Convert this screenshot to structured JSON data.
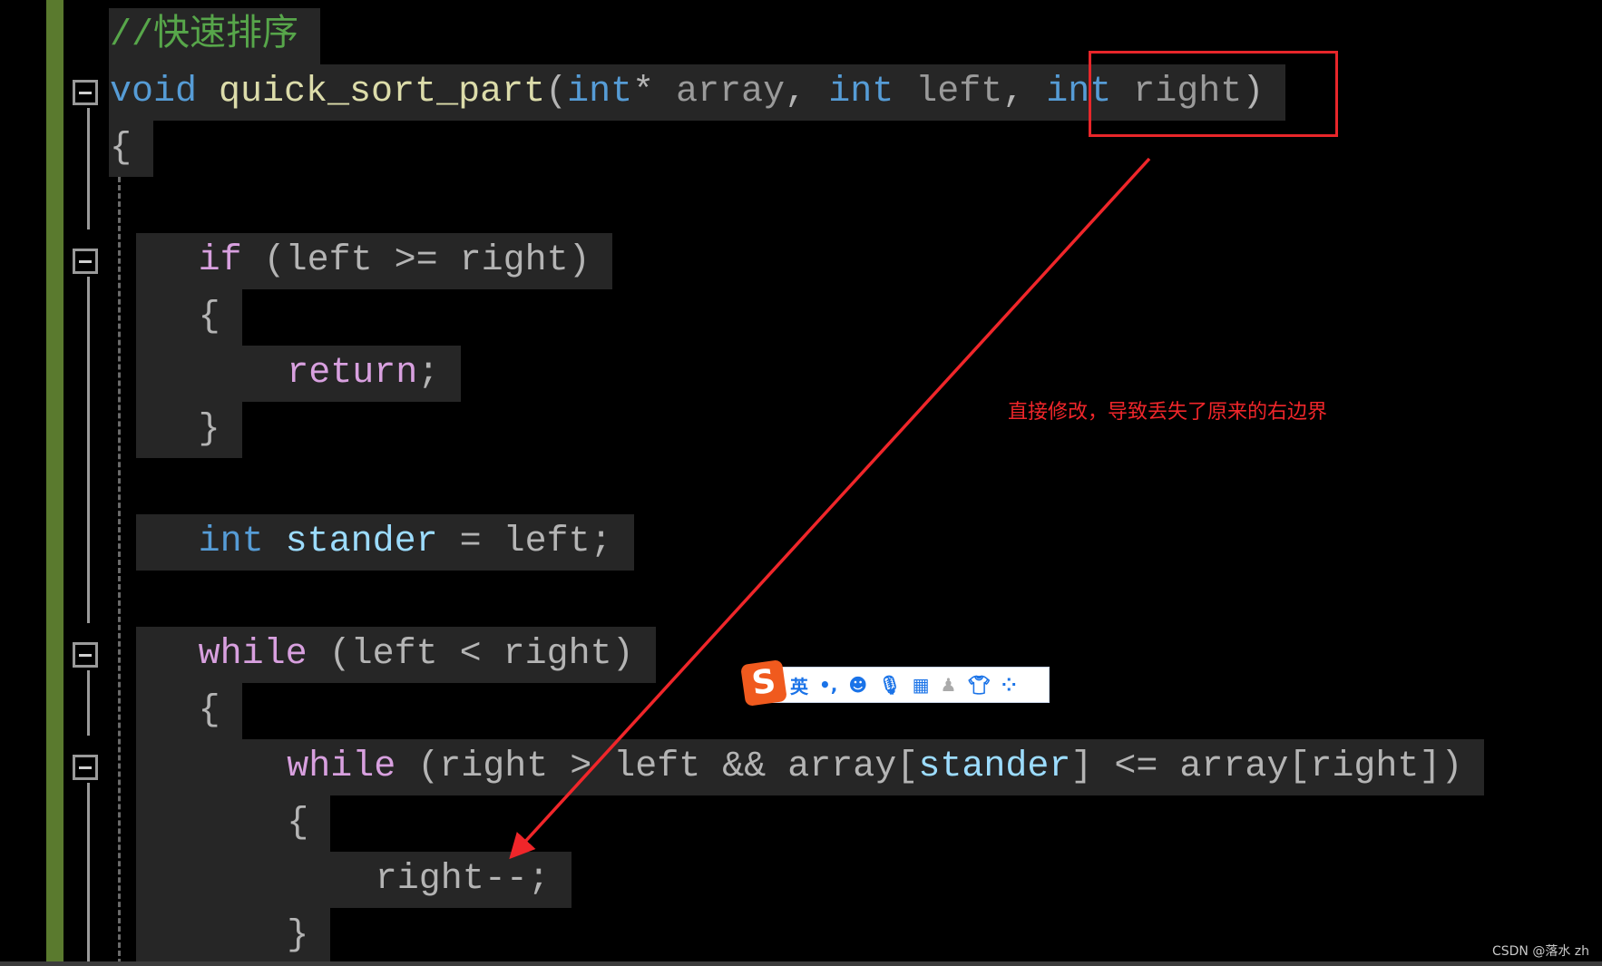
{
  "editor": {
    "lines": [
      {
        "indent": 0,
        "tokens": [
          [
            "//快速排序",
            "cm"
          ]
        ]
      },
      {
        "indent": 0,
        "tokens": [
          [
            "void",
            "kw"
          ],
          [
            " ",
            "pn"
          ],
          [
            "quick_sort_part",
            "fn"
          ],
          [
            "(",
            "pn"
          ],
          [
            "int",
            "kw"
          ],
          [
            "* ",
            "pn"
          ],
          [
            "array",
            "pm"
          ],
          [
            ", ",
            "pn"
          ],
          [
            "int",
            "kw"
          ],
          [
            " ",
            "pn"
          ],
          [
            "left",
            "pm"
          ],
          [
            ", ",
            "pn"
          ],
          [
            "int",
            "kw"
          ],
          [
            " ",
            "pn"
          ],
          [
            "right",
            "pm"
          ],
          [
            ")",
            "pn"
          ]
        ]
      },
      {
        "indent": 0,
        "tokens": [
          [
            "{",
            "pn"
          ]
        ]
      },
      {
        "indent": 1,
        "tokens": []
      },
      {
        "indent": 1,
        "tokens": [
          [
            "if",
            "ctl"
          ],
          [
            " (left >= right)",
            "pn"
          ]
        ]
      },
      {
        "indent": 1,
        "tokens": [
          [
            "{",
            "pn"
          ]
        ]
      },
      {
        "indent": 2,
        "tokens": [
          [
            "return",
            "ctl"
          ],
          [
            ";",
            "pn"
          ]
        ]
      },
      {
        "indent": 1,
        "tokens": [
          [
            "}",
            "pn"
          ]
        ]
      },
      {
        "indent": 1,
        "tokens": []
      },
      {
        "indent": 1,
        "tokens": [
          [
            "int",
            "kw"
          ],
          [
            " ",
            "pn"
          ],
          [
            "stander",
            "var"
          ],
          [
            " = left;",
            "pn"
          ]
        ]
      },
      {
        "indent": 1,
        "tokens": []
      },
      {
        "indent": 1,
        "tokens": [
          [
            "while",
            "ctl"
          ],
          [
            " (left < right)",
            "pn"
          ]
        ]
      },
      {
        "indent": 1,
        "tokens": [
          [
            "{",
            "pn"
          ]
        ]
      },
      {
        "indent": 2,
        "tokens": [
          [
            "while",
            "ctl"
          ],
          [
            " (right > left && array[",
            "pn"
          ],
          [
            "stander",
            "var"
          ],
          [
            "] <= array[right])",
            "pn"
          ]
        ]
      },
      {
        "indent": 2,
        "tokens": [
          [
            "{",
            "pn"
          ]
        ]
      },
      {
        "indent": 3,
        "tokens": [
          [
            "right--;",
            "pn"
          ]
        ]
      },
      {
        "indent": 2,
        "tokens": [
          [
            "}",
            "pn"
          ]
        ]
      }
    ]
  },
  "annotation": {
    "text": "直接修改，导致丢失了原来的右边界",
    "color": "#f0262a"
  },
  "ime_toolbar": {
    "logo": "S",
    "mode": "英",
    "punct": "•,",
    "icons": [
      "emoji-icon",
      "microphone-icon",
      "keyboard-icon",
      "user-icon",
      "skin-icon",
      "apps-icon"
    ]
  },
  "watermark": "CSDN @落水 zh"
}
